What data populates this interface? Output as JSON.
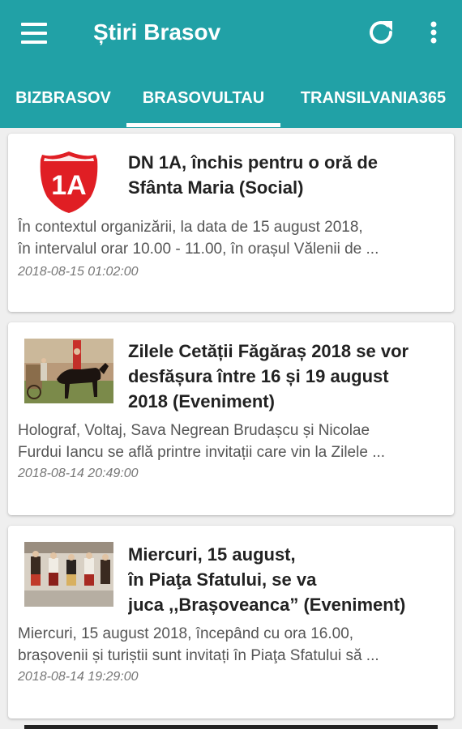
{
  "app": {
    "title": "Știri Brasov",
    "primary_color": "#21a1a6",
    "icons": {
      "menu": "hamburger-icon",
      "refresh": "refresh-icon",
      "more": "more-vertical-icon"
    }
  },
  "tabs": [
    {
      "label": "BIZBRASOV",
      "selected": false
    },
    {
      "label": "BRASOVULTAU",
      "selected": true
    },
    {
      "label": "TRANSILVANIA365",
      "selected": false
    }
  ],
  "articles": [
    {
      "title_lines": [
        "DN 1A, închis pentru o oră de",
        "Sfânta Maria (Social)"
      ],
      "excerpt_lines": [
        "În contextul organizării, la data de 15 august 2018,",
        "în intervalul orar 10.00 - 11.00, în orașul Vălenii de ..."
      ],
      "date": "2018-08-15 01:02:00",
      "thumbnail": {
        "type": "route-shield-icon",
        "text": "1A",
        "color": "#e01e24"
      }
    },
    {
      "title_lines": [
        "Zilele Cetății Făgăraș 2018 se vor",
        "desfășura între 16 și 19 august",
        "2018 (Eveniment)"
      ],
      "excerpt_lines": [
        "Holograf, Voltaj, Sava Negrean Brudașcu și Nicolae",
        "Furdui Iancu se află printre invitații care vin la Zilele ..."
      ],
      "date": "2018-08-14 20:49:00",
      "thumbnail": {
        "type": "photo-horse-rider"
      }
    },
    {
      "title_lines": [
        "Miercuri, 15 august,",
        "în Piaţa Sfatului, se va",
        "juca ,,Brașoveanca” (Eveniment)"
      ],
      "excerpt_lines": [
        "Miercuri, 15 august 2018, începând cu ora 16.00,",
        "brașovenii și turiștii sunt invitați în Piaţa Sfatului să ..."
      ],
      "date": "2018-08-14 19:29:00",
      "thumbnail": {
        "type": "photo-folk-dancers"
      }
    }
  ]
}
